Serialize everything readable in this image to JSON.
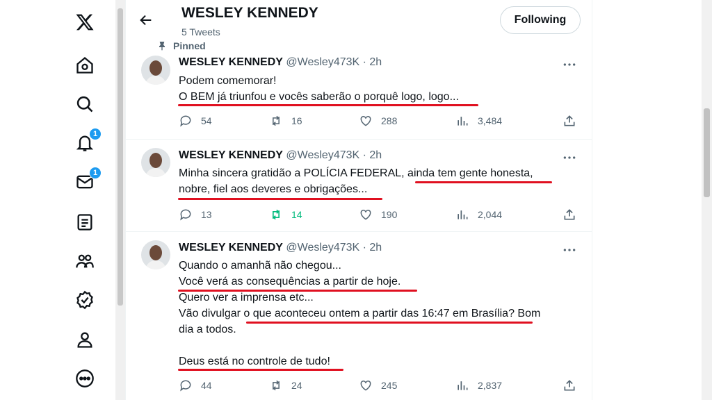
{
  "nav": {
    "items": [
      {
        "name": "x-logo-icon",
        "badge": ""
      },
      {
        "name": "home-icon",
        "badge": ""
      },
      {
        "name": "search-icon",
        "badge": ""
      },
      {
        "name": "notifications-icon",
        "badge": "1"
      },
      {
        "name": "messages-icon",
        "badge": "1"
      },
      {
        "name": "lists-icon",
        "badge": ""
      },
      {
        "name": "communities-icon",
        "badge": ""
      },
      {
        "name": "verified-icon",
        "badge": ""
      },
      {
        "name": "profile-icon",
        "badge": ""
      },
      {
        "name": "more-icon",
        "badge": ""
      }
    ]
  },
  "header": {
    "title": "WESLEY KENNEDY",
    "subtitle": "5 Tweets",
    "follow_label": "Following"
  },
  "pinned_label": "Pinned",
  "tweets": [
    {
      "name": "WESLEY KENNEDY",
      "handle": "@Wesley473K · 2h",
      "lines": [
        "Podem comemorar!",
        "O BEM já triunfou e vocês saberão o porquê logo, logo..."
      ],
      "replies": "54",
      "retweets": "16",
      "likes": "288",
      "views": "3,484"
    },
    {
      "name": "WESLEY KENNEDY",
      "handle": "@Wesley473K · 2h",
      "lines": [
        "Minha sincera gratidão a POLÍCIA FEDERAL, ainda tem gente honesta,",
        "nobre, fiel aos deveres e obrigações..."
      ],
      "replies": "13",
      "retweets": "14",
      "likes": "190",
      "views": "2,044"
    },
    {
      "name": "WESLEY KENNEDY",
      "handle": "@Wesley473K · 2h",
      "lines": [
        "Quando o amanhã não chegou...",
        "Você verá as consequências a partir de hoje.",
        "Quero ver a imprensa etc...",
        "Vão divulgar o que aconteceu ontem a partir das 16:47 em Brasília? Bom",
        "dia a todos.",
        "",
        "Deus está no controle de tudo!"
      ],
      "replies": "44",
      "retweets": "24",
      "likes": "245",
      "views": "2,837"
    }
  ],
  "colors": {
    "accent": "#1d9bf0",
    "retweet_active": "#00ba7c",
    "annotation": "#e01020",
    "muted": "#536471"
  }
}
